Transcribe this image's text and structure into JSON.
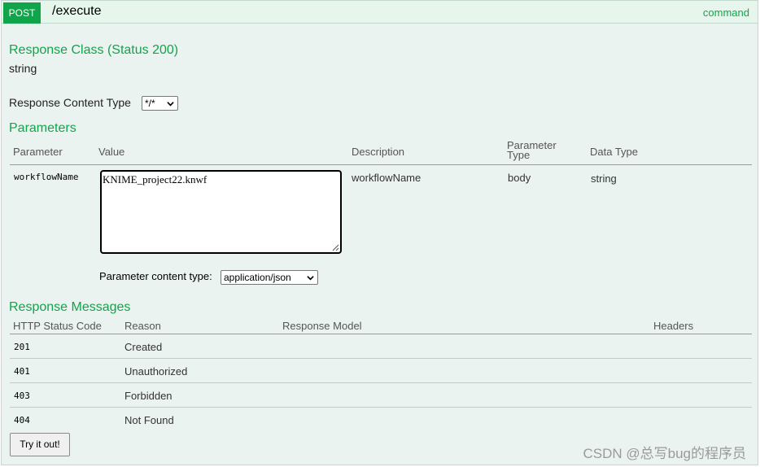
{
  "operation": {
    "method": "POST",
    "path": "/execute",
    "summary": "command"
  },
  "response_class": {
    "heading": "Response Class (Status 200)",
    "type": "string"
  },
  "response_content_type": {
    "label": "Response Content Type",
    "selected": "*/*"
  },
  "parameters": {
    "heading": "Parameters",
    "columns": [
      "Parameter",
      "Value",
      "Description",
      "Parameter Type",
      "Data Type"
    ],
    "column_type_line1": "Parameter",
    "column_type_line2": "Type",
    "rows": [
      {
        "name": "workflowName",
        "value": "KNIME_project22.knwf",
        "description": "workflowName",
        "param_type": "body",
        "data_type": "string",
        "content_type_label": "Parameter content type:",
        "content_type_selected": "application/json"
      }
    ]
  },
  "response_messages": {
    "heading": "Response Messages",
    "columns": [
      "HTTP Status Code",
      "Reason",
      "Response Model",
      "Headers"
    ],
    "rows": [
      {
        "code": "201",
        "reason": "Created"
      },
      {
        "code": "401",
        "reason": "Unauthorized"
      },
      {
        "code": "403",
        "reason": "Forbidden"
      },
      {
        "code": "404",
        "reason": "Not Found"
      }
    ]
  },
  "try_button": "Try it out!",
  "watermark": "CSDN @总写bug的程序员",
  "colors": {
    "accent_green": "#10a54a",
    "panel_bg": "#ebf3f0",
    "header_bg": "#e7f6ec"
  },
  "icons": [
    "chevron-down-icon",
    "resize-handle-icon"
  ]
}
